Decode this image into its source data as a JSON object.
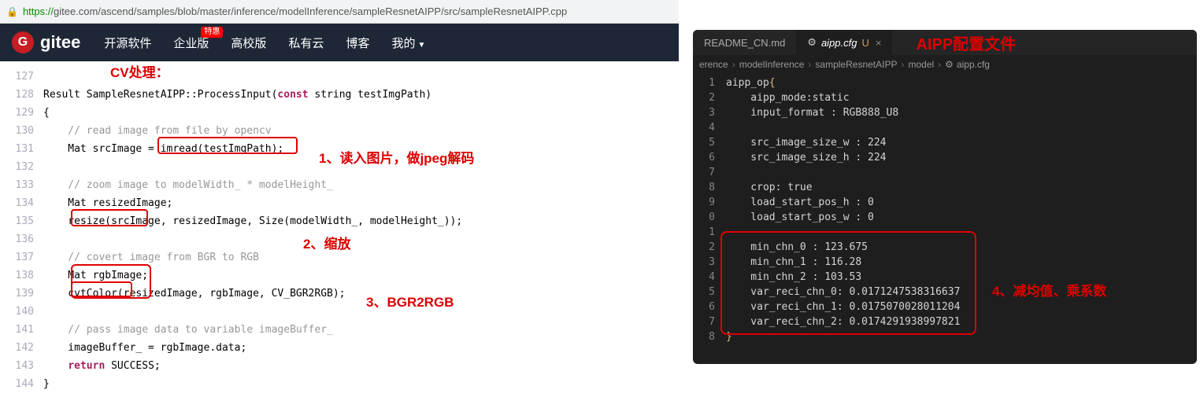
{
  "url": {
    "prefix": "https://",
    "rest": "gitee.com/ascend/samples/blob/master/inference/modelInference/sampleResnetAIPP/src/sampleResnetAIPP.cpp"
  },
  "logo": {
    "g": "G",
    "text": "gitee"
  },
  "nav": {
    "opensource": "开源软件",
    "enterprise": "企业版",
    "badge": "特惠",
    "university": "高校版",
    "private": "私有云",
    "blog": "博客",
    "my": "我的"
  },
  "annotations": {
    "cv": "CV处理：",
    "a1": "1、读入图片，做jpeg解码",
    "a2": "2、缩放",
    "a3": "3、BGR2RGB",
    "a4": "4、减均值、乘系数",
    "title": "AIPP配置文件"
  },
  "lines": [
    {
      "n": "127",
      "t": ""
    },
    {
      "n": "128",
      "t": "Result SampleResnetAIPP::ProcessInput(const string testImgPath)"
    },
    {
      "n": "129",
      "t": "{"
    },
    {
      "n": "130",
      "t": "    // read image from file by opencv"
    },
    {
      "n": "131",
      "t": "    Mat srcImage = imread(testImgPath);"
    },
    {
      "n": "132",
      "t": ""
    },
    {
      "n": "133",
      "t": "    // zoom image to modelWidth_ * modelHeight_"
    },
    {
      "n": "134",
      "t": "    Mat resizedImage;"
    },
    {
      "n": "135",
      "t": "    resize(srcImage, resizedImage, Size(modelWidth_, modelHeight_));"
    },
    {
      "n": "136",
      "t": ""
    },
    {
      "n": "137",
      "t": "    // covert image from BGR to RGB"
    },
    {
      "n": "138",
      "t": "    Mat rgbImage;"
    },
    {
      "n": "139",
      "t": "    cvtColor(resizedImage, rgbImage, CV_BGR2RGB);"
    },
    {
      "n": "140",
      "t": ""
    },
    {
      "n": "141",
      "t": "    // pass image data to variable imageBuffer_"
    },
    {
      "n": "142",
      "t": "    imageBuffer_ = rgbImage.data;"
    },
    {
      "n": "143",
      "t": "    return SUCCESS;"
    },
    {
      "n": "144",
      "t": "}"
    }
  ],
  "vscode": {
    "tab_inactive": "README_CN.md",
    "tab_active": "aipp.cfg",
    "tab_status": "U",
    "close": "×",
    "crumbs": [
      "erence",
      "modelInference",
      "sampleResnetAIPP",
      "model",
      "aipp.cfg"
    ],
    "cfg_lines_numbers": [
      "1",
      "2",
      "3",
      "4",
      "5",
      "6",
      "7",
      "8",
      "9",
      "0",
      "1",
      "2",
      "3",
      "4",
      "5",
      "6",
      "7",
      "8"
    ],
    "cfg_text": "aipp_op{\n    aipp_mode:static\n    input_format : RGB888_U8\n\n    src_image_size_w : 224\n    src_image_size_h : 224\n\n    crop: true\n    load_start_pos_h : 0\n    load_start_pos_w : 0\n\n    min_chn_0 : 123.675\n    min_chn_1 : 116.28\n    min_chn_2 : 103.53\n    var_reci_chn_0: 0.0171247538316637\n    var_reci_chn_1: 0.0175070028011204\n    var_reci_chn_2: 0.0174291938997821\n}"
  }
}
